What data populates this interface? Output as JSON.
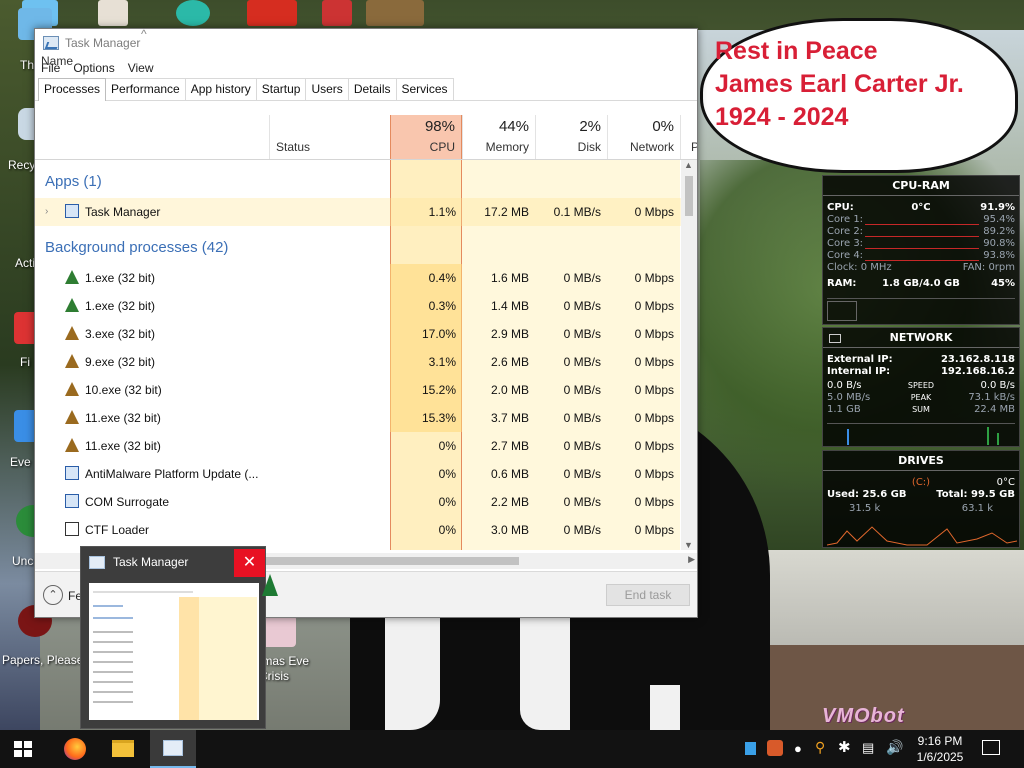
{
  "desktop": {
    "speech_bubble": [
      "Rest in Peace",
      "James Earl Carter Jr.",
      "1924 - 2024"
    ],
    "icons": [
      {
        "label": "Th"
      },
      {
        "label": "Recy"
      },
      {
        "label": "Acti"
      },
      {
        "label": "Fi"
      },
      {
        "label": "Eve"
      },
      {
        "label": "Unc"
      },
      {
        "label": "Papers, Please"
      },
      {
        "label": "tmas Eve\nCrisis"
      }
    ],
    "watermark": "VMObot"
  },
  "task_manager": {
    "title": "Task Manager",
    "menu": [
      "File",
      "Options",
      "View"
    ],
    "tabs": [
      "Processes",
      "Performance",
      "App history",
      "Startup",
      "Users",
      "Details",
      "Services"
    ],
    "active_tab": "Processes",
    "columns": {
      "name": "Name",
      "status": "Status",
      "cpu": {
        "pct": "98%",
        "label": "CPU"
      },
      "memory": {
        "pct": "44%",
        "label": "Memory"
      },
      "disk": {
        "pct": "2%",
        "label": "Disk"
      },
      "network": {
        "pct": "0%",
        "label": "Network"
      },
      "power_partial": "P"
    },
    "apps_header": "Apps (1)",
    "background_header": "Background processes (42)",
    "apps": [
      {
        "name": "Task Manager",
        "cpu": "1.1%",
        "memory": "17.2 MB",
        "disk": "0.1 MB/s",
        "network": "0 Mbps",
        "icon": "task-manager-icon"
      }
    ],
    "processes": [
      {
        "name": "1.exe (32 bit)",
        "cpu": "0.4%",
        "memory": "1.6 MB",
        "disk": "0 MB/s",
        "network": "0 Mbps",
        "icon": "green-tree-icon"
      },
      {
        "name": "1.exe (32 bit)",
        "cpu": "0.3%",
        "memory": "1.4 MB",
        "disk": "0 MB/s",
        "network": "0 Mbps",
        "icon": "green-tree-icon"
      },
      {
        "name": "3.exe (32 bit)",
        "cpu": "17.0%",
        "memory": "2.9 MB",
        "disk": "0 MB/s",
        "network": "0 Mbps",
        "icon": "brown-tree-icon"
      },
      {
        "name": "9.exe (32 bit)",
        "cpu": "3.1%",
        "memory": "2.6 MB",
        "disk": "0 MB/s",
        "network": "0 Mbps",
        "icon": "brown-tree-icon"
      },
      {
        "name": "10.exe (32 bit)",
        "cpu": "15.2%",
        "memory": "2.0 MB",
        "disk": "0 MB/s",
        "network": "0 Mbps",
        "icon": "brown-tree-icon"
      },
      {
        "name": "11.exe (32 bit)",
        "cpu": "15.3%",
        "memory": "3.7 MB",
        "disk": "0 MB/s",
        "network": "0 Mbps",
        "icon": "brown-tree-icon"
      },
      {
        "name": "11.exe (32 bit)",
        "cpu": "0%",
        "memory": "2.7 MB",
        "disk": "0 MB/s",
        "network": "0 Mbps",
        "icon": "brown-tree-icon"
      },
      {
        "name": "AntiMalware Platform Update (...",
        "cpu": "0%",
        "memory": "0.6 MB",
        "disk": "0 MB/s",
        "network": "0 Mbps",
        "icon": "window-icon"
      },
      {
        "name": "COM Surrogate",
        "cpu": "0%",
        "memory": "2.2 MB",
        "disk": "0 MB/s",
        "network": "0 Mbps",
        "icon": "window-icon"
      },
      {
        "name": "CTF Loader",
        "cpu": "0%",
        "memory": "3.0 MB",
        "disk": "0 MB/s",
        "network": "0 Mbps",
        "icon": "pen-icon"
      }
    ],
    "footer": {
      "fewer_details": "Fe",
      "end_task": "End task"
    }
  },
  "thumbnail": {
    "title": "Task Manager",
    "close": "✕"
  },
  "widgets": {
    "cpu_ram": {
      "title": "CPU-RAM",
      "cpu_label": "CPU:",
      "temp": "0°C",
      "cpu_total": "91.9%",
      "cores": [
        {
          "label": "Core 1:",
          "value": "95.4%"
        },
        {
          "label": "Core 2:",
          "value": "89.2%"
        },
        {
          "label": "Core 3:",
          "value": "90.8%"
        },
        {
          "label": "Core 4:",
          "value": "93.8%"
        }
      ],
      "clock": "Clock: 0 MHz",
      "fan": "FAN: 0rpm",
      "ram_label": "RAM:",
      "ram_value": "1.8 GB/4.0 GB",
      "ram_pct": "45%"
    },
    "network": {
      "title": "NETWORK",
      "external_label": "External IP:",
      "external_ip": "23.162.8.118",
      "internal_label": "Internal IP:",
      "internal_ip": "192.168.16.2",
      "speed_down": "0.0 B/s",
      "speed_label": "SPEED",
      "speed_up": "0.0 B/s",
      "peak_down": "5.0 MB/s",
      "peak_label": "PEAK",
      "peak_up": "73.1 kB/s",
      "sum_down": "1.1 GB",
      "sum_label": "SUM",
      "sum_up": "22.4 MB"
    },
    "drives": {
      "title": "DRIVES",
      "drive": "(C:)",
      "temp": "0°C",
      "used": "Used: 25.6 GB",
      "total": "Total: 99.5 GB",
      "read": "31.5 k",
      "write": "63.1 k"
    }
  },
  "taskbar": {
    "time": "9:16 PM",
    "date": "1/6/2025"
  },
  "colors": {
    "cpu_header": "#f9c6ae",
    "cpu_column": "#ffefc0",
    "other_columns": "#fff8dc",
    "section_header": "#3b6fb6",
    "speech_text": "#d81f36"
  }
}
